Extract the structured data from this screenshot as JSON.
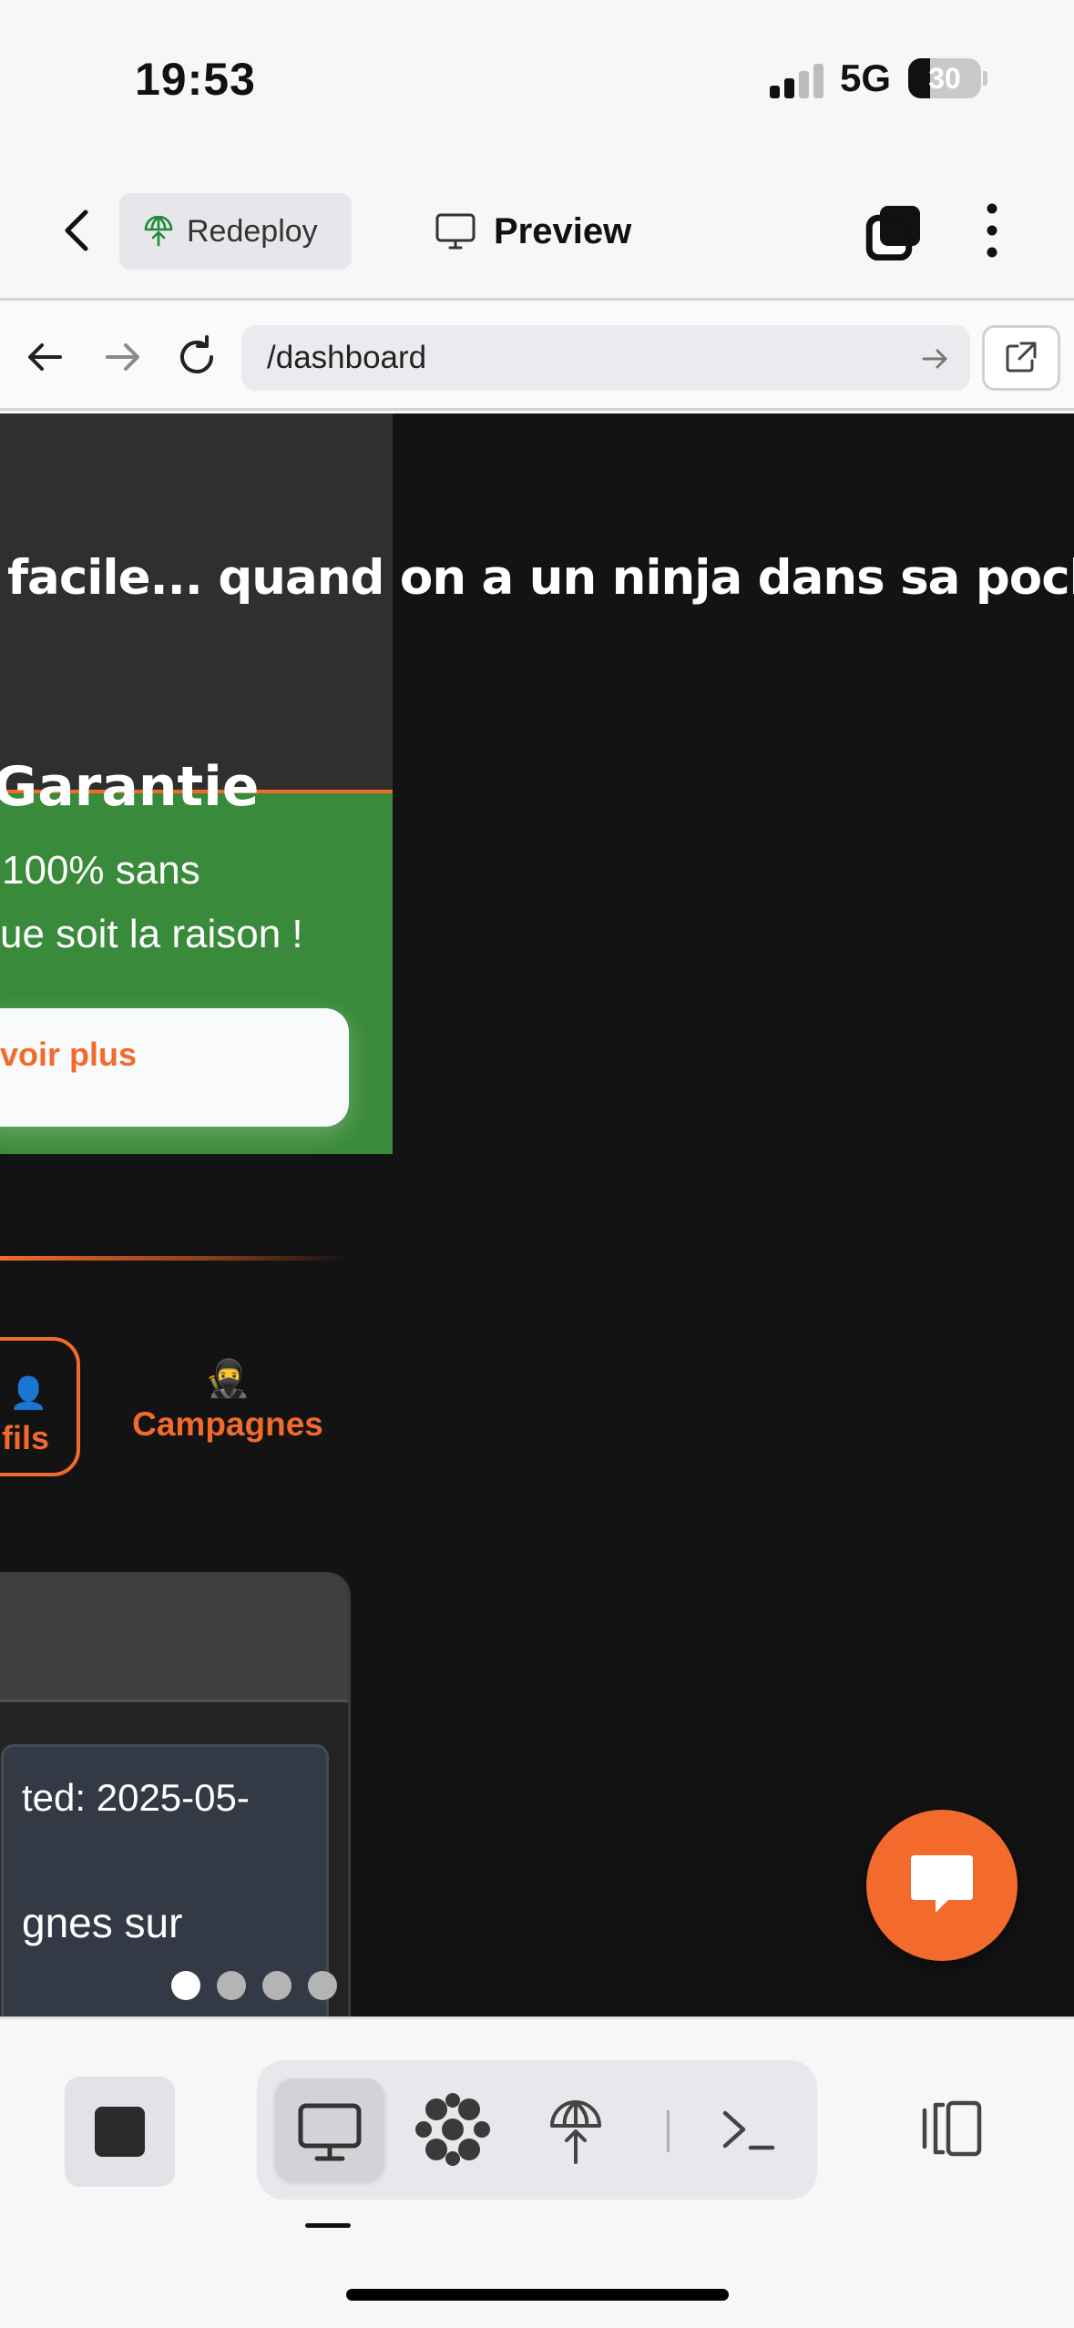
{
  "status_bar": {
    "time": "19:53",
    "network": "5G",
    "battery": "30"
  },
  "header": {
    "redeploy_label": "Redeploy",
    "preview_label": "Preview"
  },
  "address_bar": {
    "url": "/dashboard"
  },
  "page": {
    "tagline": " facile... quand on a un ninja dans sa poche\"",
    "guarantee": {
      "title": "Garantie",
      "line1": "100% sans",
      "line2": "ue soit la raison !",
      "button": "voir plus"
    },
    "tabs": [
      {
        "label": "fils",
        "icon": "👤"
      },
      {
        "label": "Campagnes",
        "icon": "🥷"
      }
    ],
    "card": {
      "line1": "ted: 2025-05-",
      "line2": "gnes sur"
    }
  },
  "colors": {
    "accent": "#f26a2c",
    "green": "#398a3a",
    "page_bg": "#131313"
  }
}
